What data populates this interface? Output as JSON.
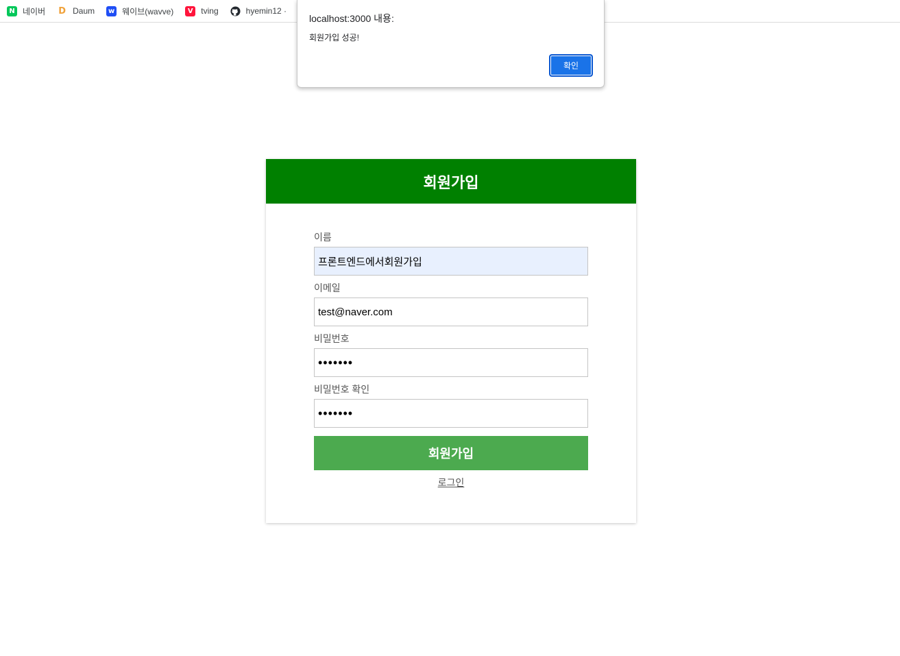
{
  "bookmarks": [
    {
      "label": "네이버",
      "icon": "naver-icon",
      "glyph": "N"
    },
    {
      "label": "Daum",
      "icon": "daum-icon",
      "glyph": "D"
    },
    {
      "label": "웨이브(wavve)",
      "icon": "wavve-icon",
      "glyph": "w"
    },
    {
      "label": "tving",
      "icon": "tving-icon",
      "glyph": "V"
    },
    {
      "label": "hyemin12 · ",
      "icon": "github-icon",
      "glyph": ""
    }
  ],
  "alert": {
    "title": "localhost:3000 내용:",
    "message": "회원가입 성공!",
    "ok_label": "확인"
  },
  "signup": {
    "title": "회원가입",
    "fields": [
      {
        "label": "이름",
        "value": "프론트엔드에서회원가입",
        "type": "text"
      },
      {
        "label": "이메일",
        "value": "test@naver.com",
        "type": "email"
      },
      {
        "label": "비밀번호",
        "value": "•••••••",
        "type": "password"
      },
      {
        "label": "비밀번호 확인",
        "value": "•••••••",
        "type": "password"
      }
    ],
    "submit_label": "회원가입",
    "login_link": "로그인"
  },
  "colors": {
    "header": "#008000",
    "submit": "#4caa4f",
    "alert_button": "#1a73e8",
    "autofill": "#e8f0fe"
  }
}
